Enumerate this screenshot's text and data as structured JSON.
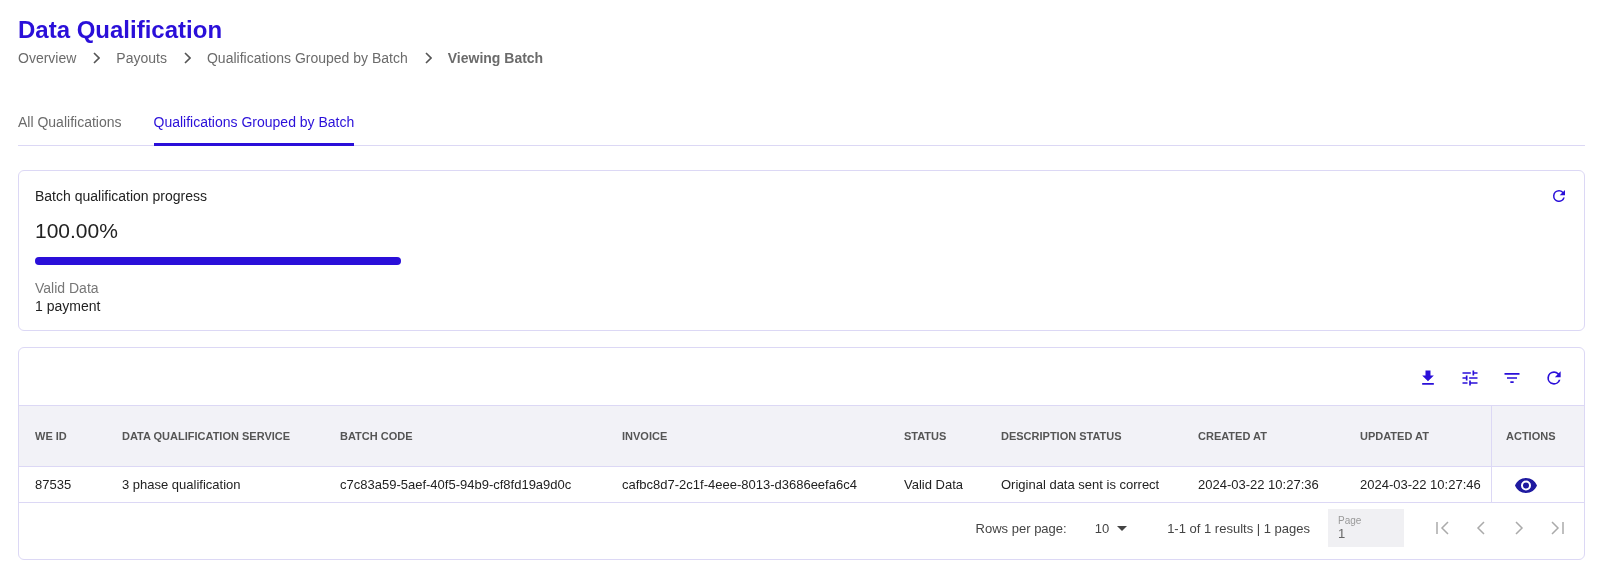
{
  "page": {
    "title": "Data Qualification"
  },
  "breadcrumb": [
    {
      "label": "Overview",
      "current": false
    },
    {
      "label": "Payouts",
      "current": false
    },
    {
      "label": "Qualifications Grouped by Batch",
      "current": false
    },
    {
      "label": "Viewing Batch",
      "current": true
    }
  ],
  "tabs": [
    {
      "label": "All Qualifications",
      "selected": false
    },
    {
      "label": "Qualifications Grouped by Batch",
      "selected": true
    }
  ],
  "progress_card": {
    "title": "Batch qualification progress",
    "percent": "100.00%",
    "level": 1,
    "status_label": "Valid Data",
    "status_count": "1 payment"
  },
  "table": {
    "columns": [
      "WE ID",
      "DATA QUALIFICATION SERVICE",
      "BATCH CODE",
      "INVOICE",
      "STATUS",
      "DESCRIPTION STATUS",
      "CREATED AT",
      "UPDATED AT",
      "ACTIONS"
    ],
    "rows": [
      {
        "cells": [
          "87535",
          "3 phase qualification",
          "c7c83a59-5aef-40f5-94b9-cf8fd19a9d0c",
          "cafbc8d7-2c1f-4eee-8013-d3686eefa6c4",
          "Valid Data",
          "Original data sent is correct",
          "2024-03-22 10:27:36",
          "2024-03-22 10:27:46"
        ]
      }
    ]
  },
  "pagination": {
    "rows_per_page_label": "Rows per page:",
    "rows_per_page": "10",
    "summary": "1-1 of 1 results | 1 pages",
    "page_label": "Page",
    "page_value": "1"
  }
}
